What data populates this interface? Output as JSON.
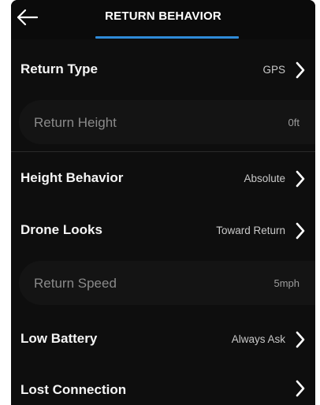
{
  "header": {
    "title": "RETURN BEHAVIOR",
    "back_icon": "back-arrow-icon",
    "accent_color": "#2f8bd8"
  },
  "settings": {
    "return_type": {
      "label": "Return Type",
      "value": "GPS"
    },
    "return_height": {
      "label": "Return Height",
      "value": "0ft"
    },
    "height_behavior": {
      "label": "Height Behavior",
      "value": "Absolute"
    },
    "drone_looks": {
      "label": "Drone Looks",
      "value": "Toward Return"
    },
    "return_speed": {
      "label": "Return Speed",
      "value": "5mph"
    },
    "low_battery": {
      "label": "Low Battery",
      "value": "Always Ask"
    },
    "lost_connection": {
      "label": "Lost Connection",
      "value": ""
    }
  },
  "icons": {
    "chevron": "chevron-right-icon"
  }
}
